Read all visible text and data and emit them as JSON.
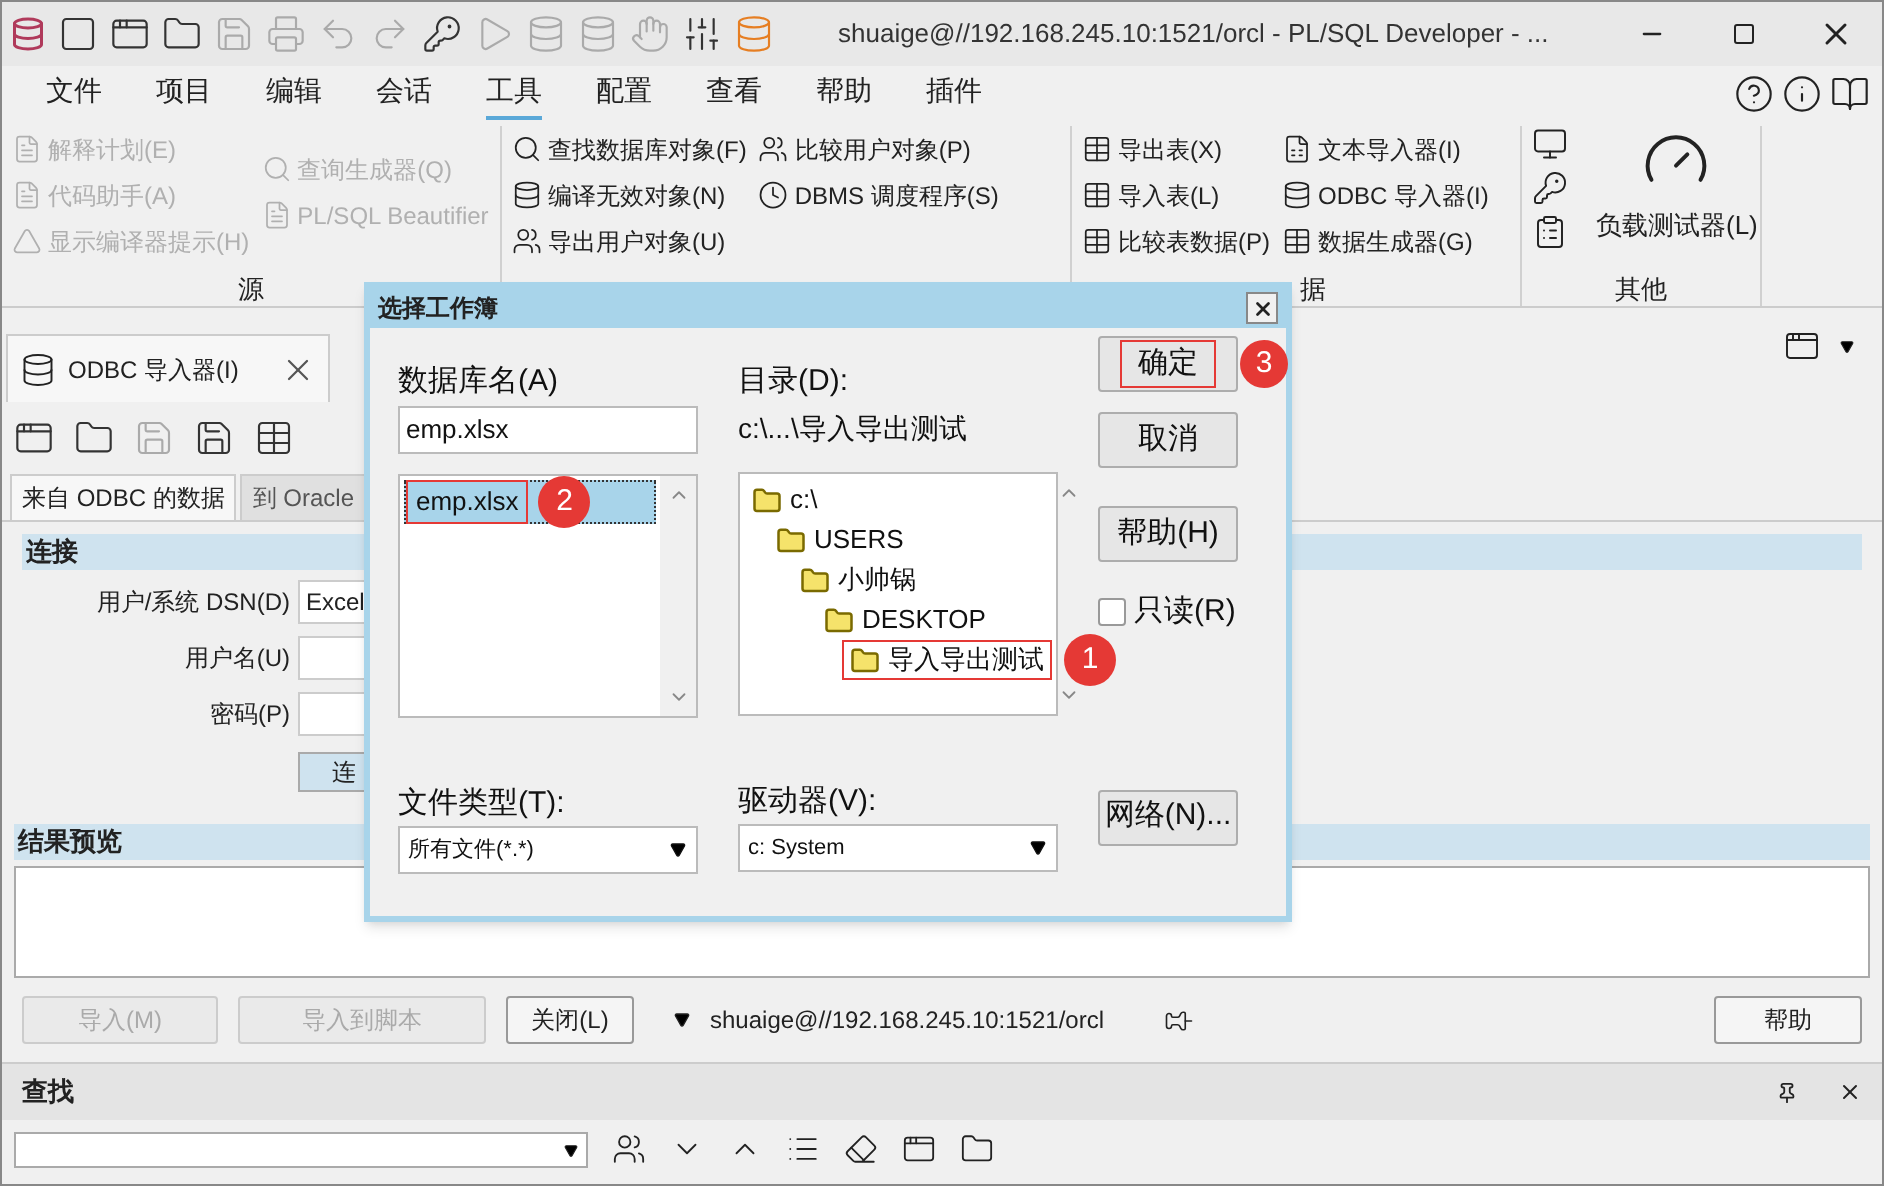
{
  "title_bar": {
    "title": "shuaige@//192.168.245.10:1521/orcl - PL/SQL Developer - ..."
  },
  "menu": [
    {
      "label": "文件",
      "selected": false
    },
    {
      "label": "项目",
      "selected": false
    },
    {
      "label": "编辑",
      "selected": false
    },
    {
      "label": "会话",
      "selected": false
    },
    {
      "label": "工具",
      "selected": true
    },
    {
      "label": "配置",
      "selected": false
    },
    {
      "label": "查看",
      "selected": false
    },
    {
      "label": "帮助",
      "selected": false
    },
    {
      "label": "插件",
      "selected": false
    }
  ],
  "ribbon": [
    {
      "label": "源",
      "columns": [
        [
          {
            "label": "解释计划(E)",
            "disabled": true
          },
          {
            "label": "代码助手(A)",
            "disabled": true
          },
          {
            "label": "显示编译器提示(H)",
            "disabled": true
          }
        ],
        [
          {
            "label": "查询生成器(Q)",
            "disabled": true
          },
          {
            "label": "PL/SQL Beautifier",
            "disabled": true
          }
        ]
      ]
    },
    {
      "columns": [
        [
          {
            "label": "查找数据库对象(F)",
            "disabled": false
          },
          {
            "label": "编译无效对象(N)",
            "disabled": false
          },
          {
            "label": "导出用户对象(U)",
            "disabled": false
          }
        ],
        [
          {
            "label": "比较用户对象(P)",
            "disabled": false
          },
          {
            "label": "DBMS 调度程序(S)",
            "disabled": false
          }
        ]
      ]
    },
    {
      "label": "据",
      "columns": [
        [
          {
            "label": "导出表(X)",
            "disabled": false
          },
          {
            "label": "导入表(L)",
            "disabled": false
          },
          {
            "label": "比较表数据(P)",
            "disabled": false
          }
        ],
        [
          {
            "label": "文本导入器(I)",
            "disabled": false
          },
          {
            "label": "ODBC 导入器(I)",
            "disabled": false
          },
          {
            "label": "数据生成器(G)",
            "disabled": false
          }
        ]
      ]
    },
    {
      "label": "其他",
      "big": {
        "label": "负载测试器(L)"
      }
    }
  ],
  "doc_tab": {
    "label": "ODBC 导入器(I)"
  },
  "sub_tabs": [
    {
      "label": "来自 ODBC 的数据",
      "selected": true
    },
    {
      "label": "到 Oracle",
      "selected": false
    }
  ],
  "connection": {
    "header": "连接",
    "fields": [
      {
        "label": "用户/系统 DSN(D)",
        "value": "Excel"
      },
      {
        "label": "用户名(U)"
      },
      {
        "label": "密码(P)"
      }
    ],
    "button": "连"
  },
  "preview": {
    "header": "结果预览"
  },
  "bottom_buttons": [
    {
      "label": "导入(M)",
      "disabled": true
    },
    {
      "label": "导入到脚本",
      "disabled": true
    },
    {
      "label": "关闭(L)",
      "disabled": false
    }
  ],
  "connection_name": "shuaige@//192.168.245.10:1521/orcl",
  "help_button": "帮助",
  "find_panel": {
    "title": "查找"
  },
  "dialog": {
    "title": "选择工作簿",
    "db_label": "数据库名(A)",
    "db_value": "emp.xlsx",
    "files": [
      {
        "label": "emp.xlsx",
        "selected": true,
        "callout": "2"
      }
    ],
    "dir_label": "目录(D):",
    "dir_path": "c:\\...\\导入导出测试",
    "tree": [
      {
        "label": "c:\\",
        "selected": false,
        "children": [
          {
            "label": "USERS",
            "selected": false,
            "children": [
              {
                "label": "小帅锅",
                "selected": false,
                "children": [
                  {
                    "label": "DESKTOP",
                    "selected": false,
                    "children": [
                      {
                        "label": "导入导出测试",
                        "selected": true,
                        "callout": "1"
                      }
                    ]
                  }
                ]
              }
            ]
          }
        ]
      }
    ],
    "type_label": "文件类型(T):",
    "type_value": "所有文件(*.*)",
    "drive_label": "驱动器(V):",
    "drive_value": "c: System",
    "buttons": [
      {
        "label": "确定",
        "callout": "3"
      },
      {
        "label": "取消"
      },
      {
        "label": "帮助(H)"
      }
    ],
    "readonly": {
      "label": "只读(R)",
      "checked": false
    },
    "network_button": "网络(N)..."
  }
}
